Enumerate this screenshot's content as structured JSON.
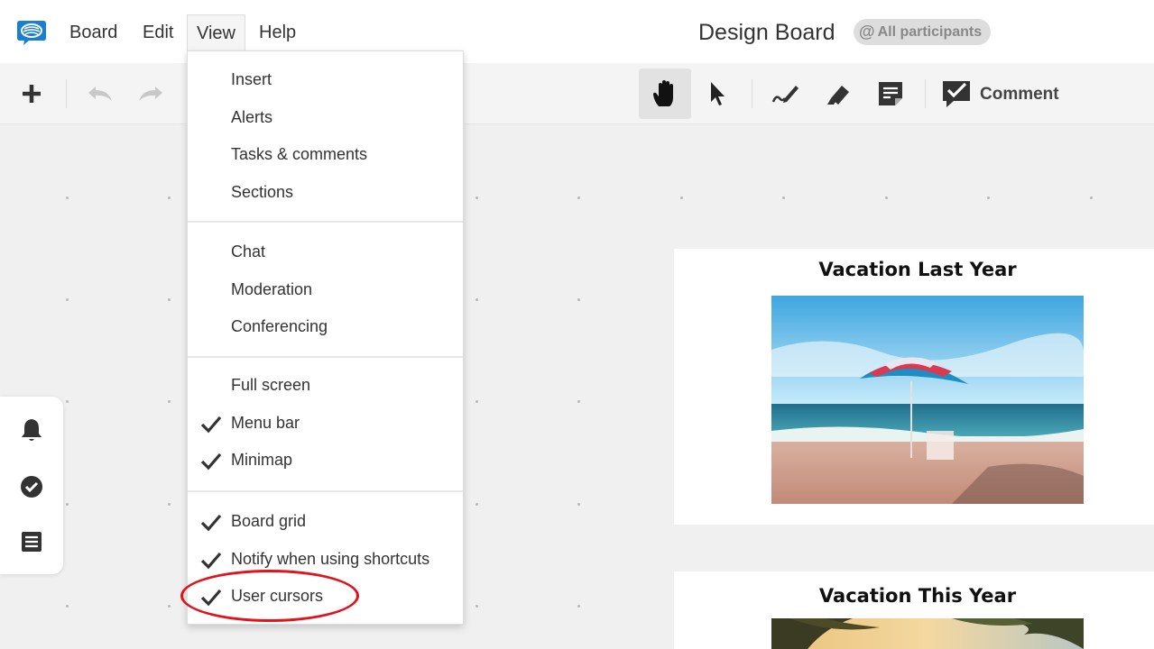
{
  "menubar": {
    "items": [
      {
        "label": "Board"
      },
      {
        "label": "Edit"
      },
      {
        "label": "View"
      },
      {
        "label": "Help"
      }
    ],
    "board_title": "Design Board",
    "participants": {
      "at": "@",
      "label": "All participants"
    }
  },
  "toolbar": {
    "tools": [
      "add-icon",
      "undo-icon",
      "redo-icon",
      "hand-icon",
      "pointer-icon",
      "pen-icon",
      "highlighter-icon",
      "sticky-note-icon",
      "comment-icon"
    ],
    "selected_tool": "hand-icon",
    "comment_label": "Comment"
  },
  "view_menu": {
    "groups": [
      {
        "items": [
          {
            "label": "Insert",
            "checked": false
          },
          {
            "label": "Alerts",
            "checked": false
          },
          {
            "label": "Tasks & comments",
            "checked": false
          },
          {
            "label": "Sections",
            "checked": false
          }
        ]
      },
      {
        "items": [
          {
            "label": "Chat",
            "checked": false
          },
          {
            "label": "Moderation",
            "checked": false
          },
          {
            "label": "Conferencing",
            "checked": false
          }
        ]
      },
      {
        "items": [
          {
            "label": "Full screen",
            "checked": false
          },
          {
            "label": "Menu bar",
            "checked": true
          },
          {
            "label": "Minimap",
            "checked": true
          }
        ]
      },
      {
        "items": [
          {
            "label": "Board grid",
            "checked": true
          },
          {
            "label": "Notify when using shortcuts",
            "checked": true
          },
          {
            "label": "User cursors",
            "checked": true
          }
        ]
      }
    ]
  },
  "sidebar": {
    "icons": [
      "bell-icon",
      "check-circle-icon",
      "list-icon"
    ]
  },
  "cards": [
    {
      "title": "Vacation Last Year"
    },
    {
      "title": "Vacation This Year"
    }
  ],
  "colors": {
    "accent": "#1a7fd4",
    "annotation": "#e0141c",
    "canvas": "#f0f0f0"
  }
}
